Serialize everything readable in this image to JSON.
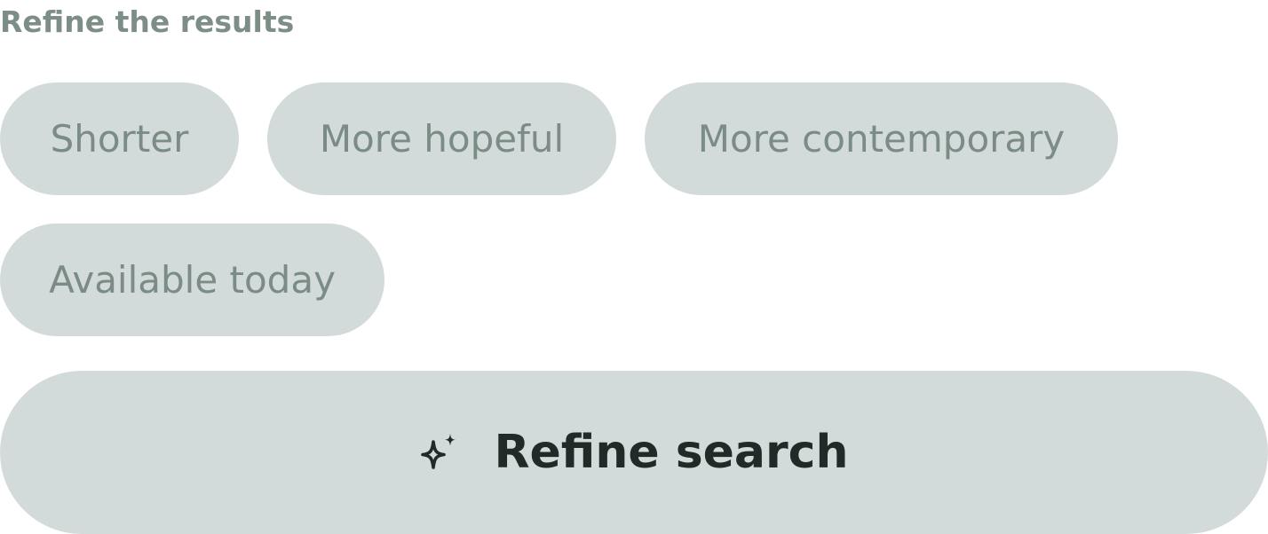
{
  "section": {
    "heading": "Refine the results"
  },
  "chips": [
    {
      "label": "Shorter"
    },
    {
      "label": "More hopeful"
    },
    {
      "label": "More contemporary"
    },
    {
      "label": "Available today"
    }
  ],
  "refine_button": {
    "label": "Refine search",
    "icon": "sparkle-icon"
  },
  "colors": {
    "chip_background": "#d3dbda",
    "chip_text": "#7b8c86",
    "heading_text": "#7d8e87",
    "button_text": "#202a27"
  }
}
